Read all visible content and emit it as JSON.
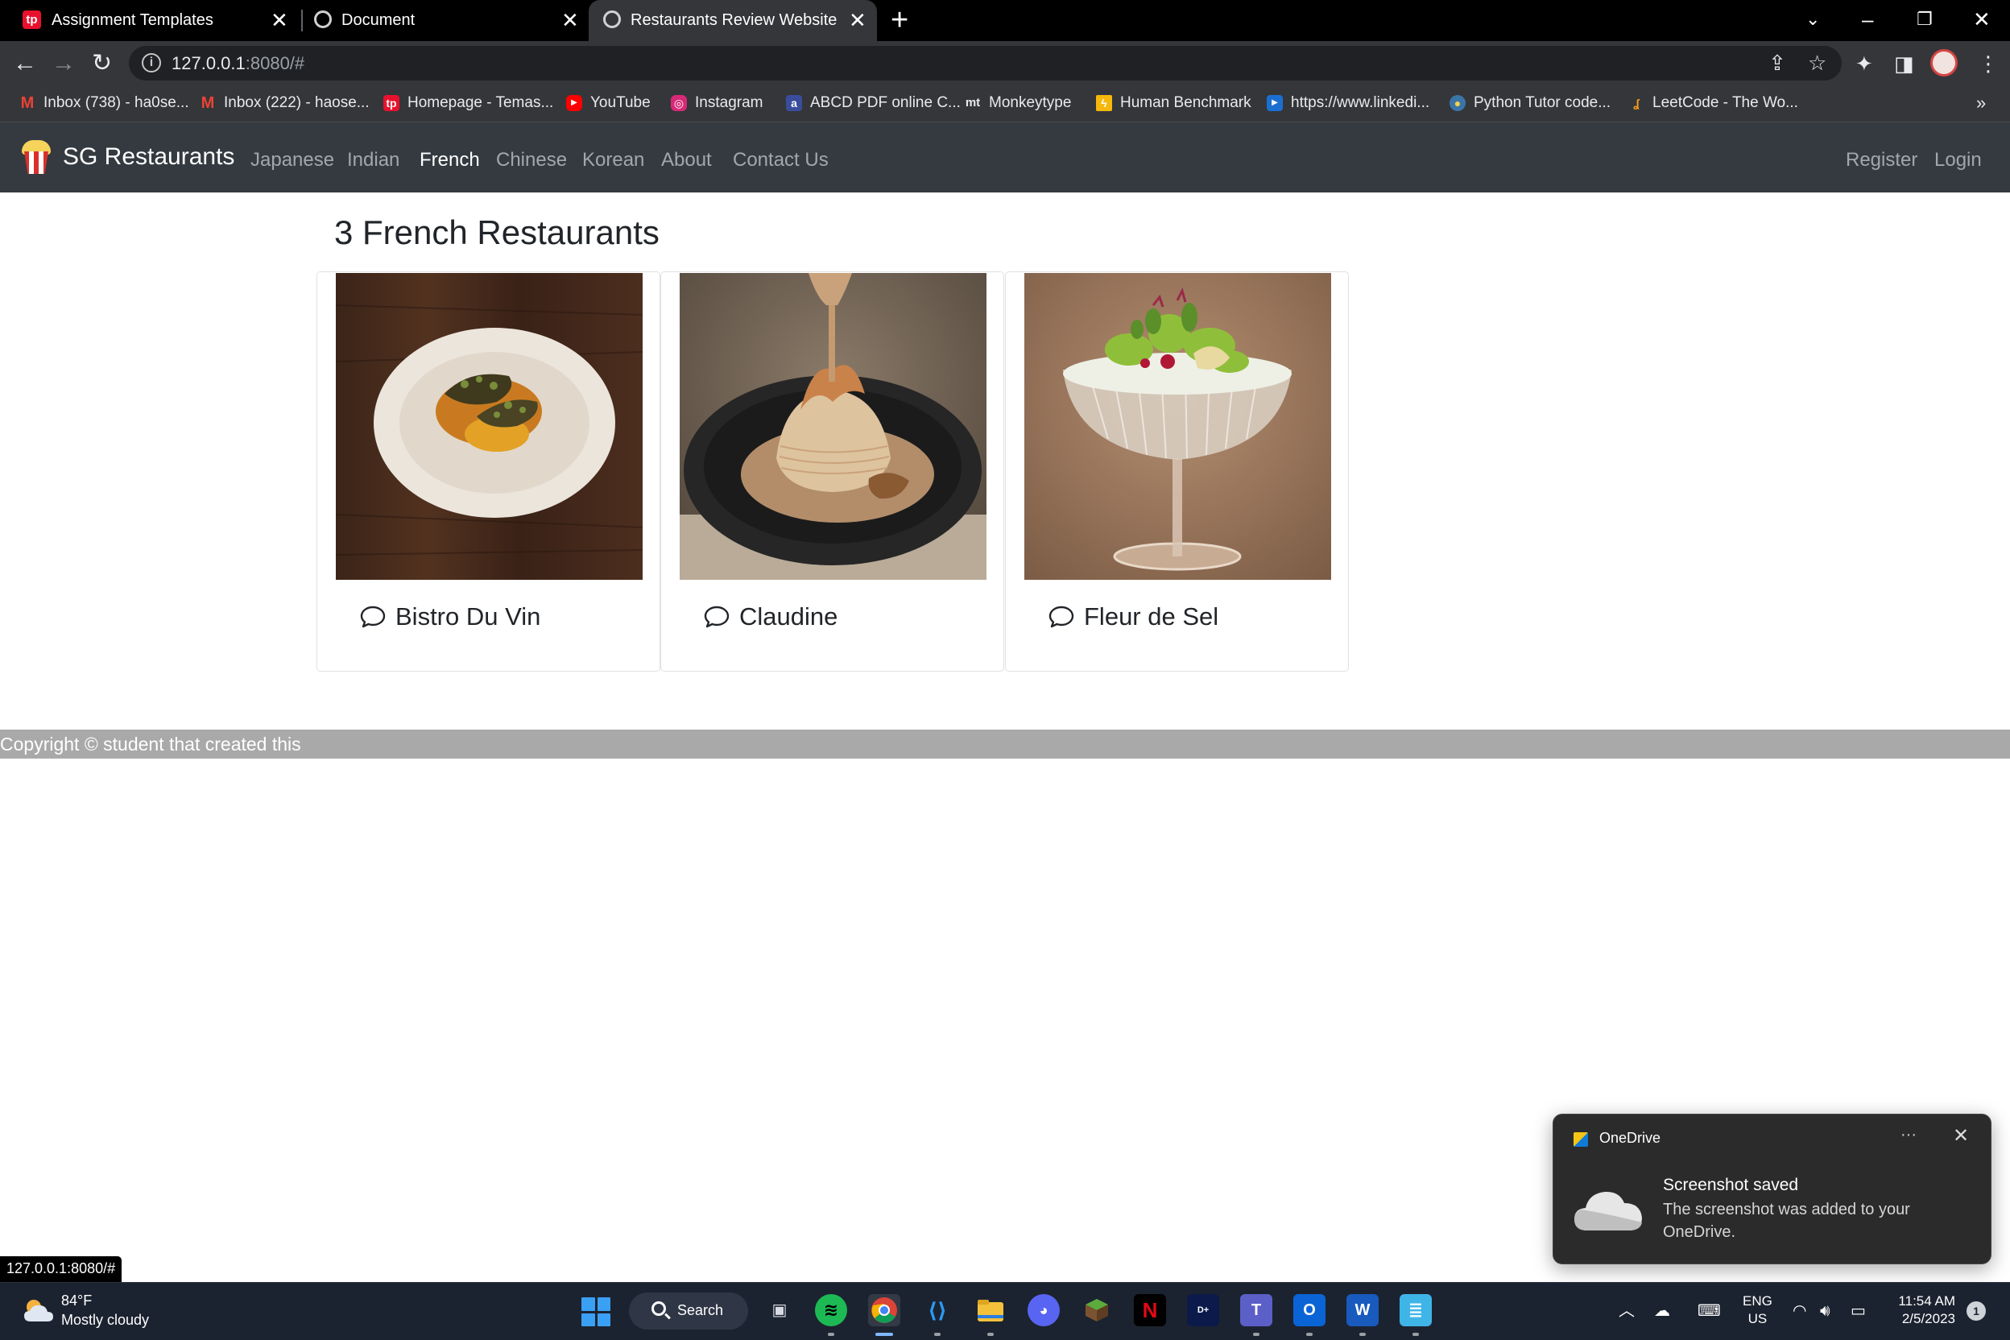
{
  "browser": {
    "tabs": [
      {
        "title": "Assignment Templates",
        "favicon": "temasek-poly-icon",
        "active": false
      },
      {
        "title": "Document",
        "favicon": "globe-icon",
        "active": false
      },
      {
        "title": "Restaurants Review Website",
        "favicon": "globe-icon",
        "active": true
      }
    ],
    "tab_close_glyph": "✕",
    "new_tab_glyph": "+",
    "url_host": "127.0.0.1",
    "url_rest": ":8080/#",
    "bookmarks": [
      {
        "label": "Inbox (738) - ha0se...",
        "icon": "gmail-icon"
      },
      {
        "label": "Inbox (222) - haose...",
        "icon": "gmail-icon"
      },
      {
        "label": "Homepage - Temas...",
        "icon": "temasek-poly-icon"
      },
      {
        "label": "YouTube",
        "icon": "youtube-icon"
      },
      {
        "label": "Instagram",
        "icon": "instagram-icon"
      },
      {
        "label": "ABCD PDF online C...",
        "icon": "pdf-icon"
      },
      {
        "label": "Monkeytype",
        "icon": "monkeytype-icon"
      },
      {
        "label": "Human Benchmark",
        "icon": "human-benchmark-icon"
      },
      {
        "label": "https://www.linkedi...",
        "icon": "linkedin-learning-icon"
      },
      {
        "label": "Python Tutor code...",
        "icon": "python-icon"
      },
      {
        "label": "LeetCode - The Wo...",
        "icon": "leetcode-icon"
      }
    ],
    "bookmarks_more": "»"
  },
  "site": {
    "brand": "SG Restaurants",
    "nav": [
      {
        "label": "Japanese",
        "active": false
      },
      {
        "label": "Indian",
        "active": false
      },
      {
        "label": "French",
        "active": true
      },
      {
        "label": "Chinese",
        "active": false
      },
      {
        "label": "Korean",
        "active": false
      },
      {
        "label": "About",
        "active": false
      },
      {
        "label": "Contact Us",
        "active": false
      }
    ],
    "auth": {
      "register": "Register",
      "login": "Login"
    },
    "heading": "3 French Restaurants",
    "restaurants": [
      {
        "name": "Bistro Du Vin",
        "image": "plated-dish-photo"
      },
      {
        "name": "Claudine",
        "image": "skillet-dish-photo"
      },
      {
        "name": "Fleur de Sel",
        "image": "salad-coupe-photo"
      }
    ],
    "footer": "Copyright © student that created this"
  },
  "status_url": "127.0.0.1:8080/#",
  "toast": {
    "app": "OneDrive",
    "more": "···",
    "title": "Screenshot saved",
    "body": "The screenshot was added to your OneDrive."
  },
  "taskbar": {
    "weather_temp": "84°F",
    "weather_desc": "Mostly cloudy",
    "search_label": "Search",
    "lang_line1": "ENG",
    "lang_line2": "US",
    "time": "11:54 AM",
    "date": "2/5/2023",
    "notification_count": "1"
  },
  "colors": {
    "navbar_bg": "#343a40",
    "footer_bg": "#a9a9a9",
    "taskbar_bg": "#1c2330"
  }
}
